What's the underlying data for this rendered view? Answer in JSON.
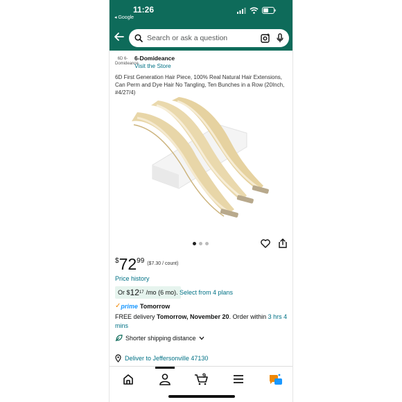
{
  "status": {
    "time": "11:26",
    "back_app": "◂ Google"
  },
  "search": {
    "placeholder": "Search or ask a question"
  },
  "store": {
    "logo_text": "6D 6-Domideance",
    "name": "6-Domideance",
    "visit_label": "Visit the Store"
  },
  "product": {
    "title": "6D First Generation Hair Piece, 100% Real Natural Hair Extensions, Can Perm and Dye Hair No Tangling, Ten Bunches in a Row (20Inch, #4/27/4)",
    "carousel": {
      "count": 3,
      "active": 0
    }
  },
  "price": {
    "symbol": "$",
    "whole": "72",
    "fraction": "99",
    "unit": "($7.30 / count)",
    "history_label": "Price history",
    "monthly_prefix": "Or $",
    "monthly_whole": "12",
    "monthly_fraction": "17",
    "monthly_suffix": "/mo (6 mo).",
    "plans_label": "Select from 4 plans"
  },
  "prime": {
    "brand": "prime",
    "label": "Tomorrow"
  },
  "delivery": {
    "text_1": "FREE delivery ",
    "date": "Tomorrow, November 20",
    "text_2": ". Order within ",
    "countdown": "3 hrs 4 mins"
  },
  "shipping": {
    "label": "Shorter shipping distance"
  },
  "deliver_to": {
    "label": "Deliver to Jeffersonville 47130"
  },
  "nav": {
    "cart_count": "9"
  },
  "colors": {
    "header": "#0e6b5a",
    "link": "#007185",
    "prime": "#1a98ff"
  }
}
